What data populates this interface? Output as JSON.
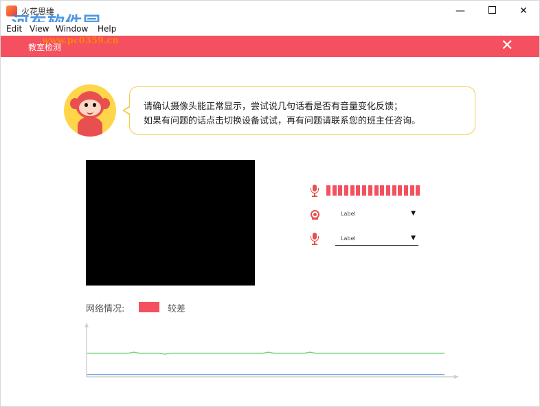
{
  "window": {
    "title": "火花思维",
    "watermark": "河东软件园",
    "watermark_url": "www.pc0359.cn",
    "controls": {
      "minimize": "—",
      "close": "✕"
    }
  },
  "menu": {
    "items": [
      "Edit",
      "View",
      "Window",
      "Help"
    ]
  },
  "header": {
    "title": "教室检测",
    "close": "✕",
    "color": "#f4505f"
  },
  "instructions": {
    "line1": "请确认摄像头能正常显示，尝试说几句话看是否有音量变化反馈；",
    "line2": "如果有问题的话点击切换设备试试，再有问题请联系您的班主任咨询。"
  },
  "devices": {
    "camera_select": {
      "value": "Label"
    },
    "mic_select": {
      "value": "Label"
    },
    "mic_level": 1.0
  },
  "network": {
    "label": "网络情况:",
    "status": "较差",
    "status_color": "#f4505f"
  },
  "chart_data": {
    "type": "line",
    "series": [
      {
        "color": "#6fd57a",
        "values": [
          0.45,
          0.45,
          0.45,
          0.45,
          0.45,
          0.45,
          0.45,
          0.45,
          0.45,
          0.47,
          0.45,
          0.45,
          0.45,
          0.45,
          0.45,
          0.43,
          0.45,
          0.45,
          0.45,
          0.45,
          0.45,
          0.45,
          0.45,
          0.45,
          0.45,
          0.45,
          0.45,
          0.45,
          0.45,
          0.45,
          0.45,
          0.45,
          0.45,
          0.45,
          0.45,
          0.47,
          0.45,
          0.45,
          0.45,
          0.45,
          0.45,
          0.45,
          0.45,
          0.47,
          0.45,
          0.45,
          0.45,
          0.45,
          0.45,
          0.45,
          0.45,
          0.45,
          0.45,
          0.45,
          0.45,
          0.45,
          0.45,
          0.45,
          0.45,
          0.45,
          0.45,
          0.45,
          0.45,
          0.45,
          0.45,
          0.45,
          0.45,
          0.45,
          0.45,
          0.45
        ]
      },
      {
        "color": "#7aa6e8",
        "values": [
          0.02,
          0.02,
          0.02,
          0.02,
          0.02,
          0.02,
          0.02,
          0.02,
          0.02,
          0.02,
          0.02,
          0.02,
          0.02,
          0.02,
          0.02,
          0.02,
          0.02,
          0.02,
          0.02,
          0.02,
          0.02,
          0.02,
          0.02,
          0.02,
          0.02,
          0.02,
          0.02,
          0.02,
          0.02,
          0.02,
          0.02,
          0.02,
          0.02,
          0.02,
          0.02,
          0.02,
          0.02,
          0.02,
          0.02,
          0.02,
          0.02,
          0.02,
          0.02,
          0.02,
          0.02,
          0.02,
          0.02,
          0.02,
          0.02,
          0.02,
          0.02,
          0.02,
          0.02,
          0.02,
          0.02,
          0.02,
          0.02,
          0.02,
          0.02,
          0.02,
          0.02,
          0.02,
          0.02,
          0.02,
          0.02,
          0.02,
          0.02,
          0.02,
          0.02,
          0.02
        ]
      }
    ],
    "ylim": [
      0,
      1
    ],
    "grid": false,
    "legend": "none"
  }
}
